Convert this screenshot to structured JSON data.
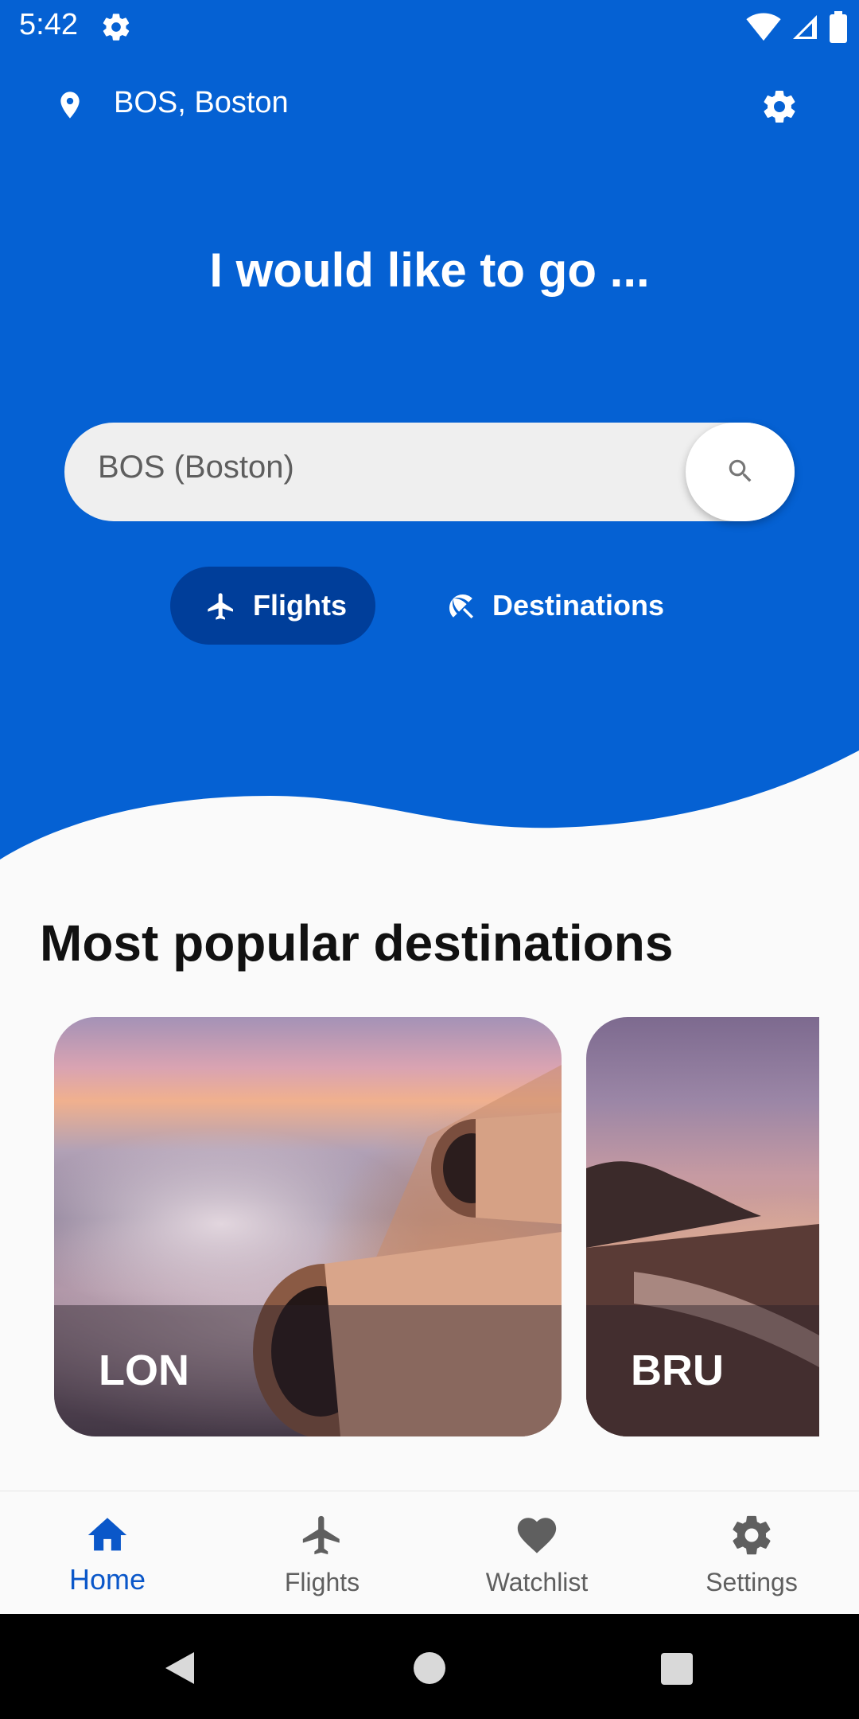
{
  "status_bar": {
    "time": "5:42",
    "icons": [
      "settings-gear-icon",
      "wifi-icon",
      "signal-icon",
      "battery-icon"
    ]
  },
  "header": {
    "location_icon": "location-pin-icon",
    "location": "BOS, Boston",
    "settings_icon": "gear-icon"
  },
  "hero": {
    "headline": "I would like to go ...",
    "search_value": "BOS (Boston)",
    "search_icon": "search-icon"
  },
  "tabs": [
    {
      "label": "Flights",
      "icon": "airplane-icon",
      "selected": true
    },
    {
      "label": "Destinations",
      "icon": "beach-umbrella-icon",
      "selected": false
    }
  ],
  "section": {
    "title": "Most popular destinations"
  },
  "destinations": [
    {
      "code": "LON"
    },
    {
      "code": "BRU"
    }
  ],
  "bottom_nav": [
    {
      "label": "Home",
      "icon": "home-icon",
      "active": true
    },
    {
      "label": "Flights",
      "icon": "airplane-icon",
      "active": false
    },
    {
      "label": "Watchlist",
      "icon": "heart-icon",
      "active": false
    },
    {
      "label": "Settings",
      "icon": "gear-icon",
      "active": false
    }
  ],
  "colors": {
    "primary": "#0561d3",
    "primary_dark": "#003e9a",
    "active_nav": "#0a57c9",
    "background": "#fafafa"
  }
}
